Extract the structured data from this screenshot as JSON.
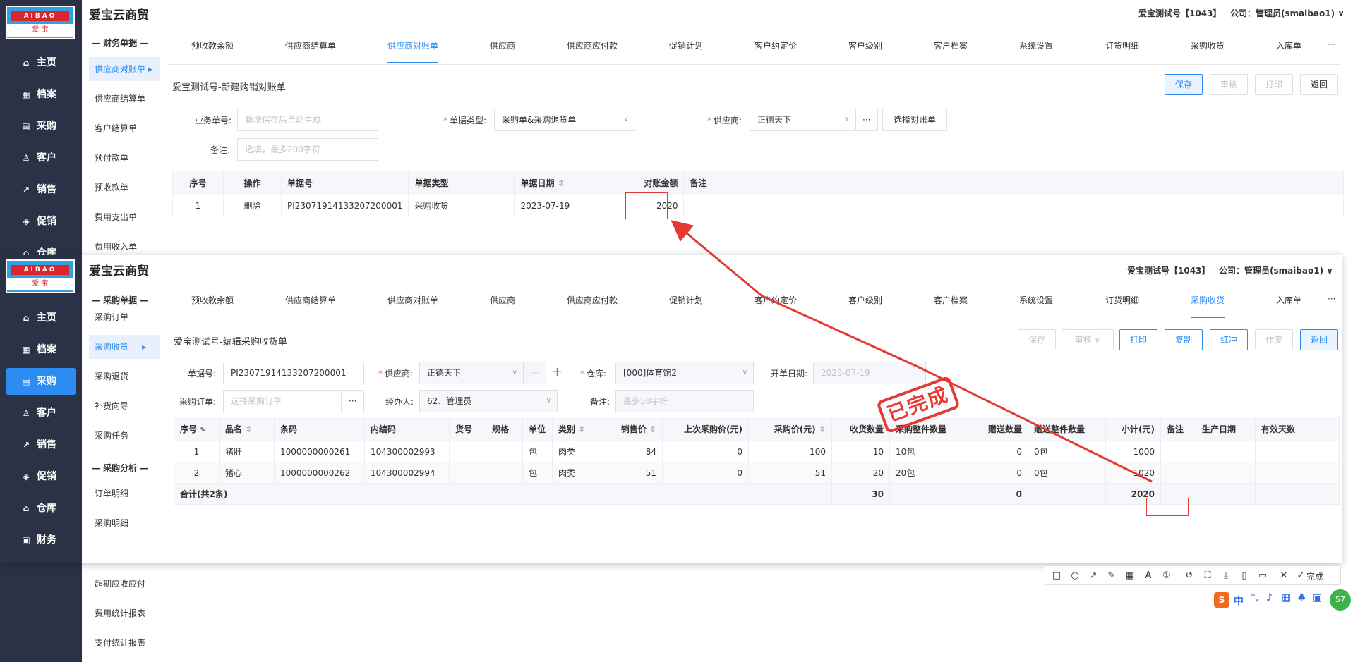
{
  "app": {
    "title": "爱宝云商贸",
    "user": "爱宝测试号【1043】",
    "company": "公司：管理员(smaibao1)",
    "logo_top": "AIBAO",
    "logo_bottom": "爱 宝"
  },
  "back": {
    "nav": [
      {
        "label": "主页",
        "icon": "home-icon"
      },
      {
        "label": "档案",
        "icon": "archive-icon"
      },
      {
        "label": "采购",
        "icon": "purchase-icon"
      },
      {
        "label": "客户",
        "icon": "customer-icon"
      },
      {
        "label": "销售",
        "icon": "sales-icon"
      },
      {
        "label": "促销",
        "icon": "promo-icon"
      },
      {
        "label": "仓库",
        "icon": "warehouse-icon"
      }
    ],
    "section": "— 财务单据 —",
    "sub": [
      "供应商对账单",
      "供应商结算单",
      "客户结算单",
      "预付款单",
      "预收款单",
      "费用支出单",
      "费用收入单"
    ],
    "sub_tail": [
      "超期应收应付",
      "费用统计报表",
      "支付统计报表"
    ],
    "tabs": [
      "预收款余额",
      "供应商结算单",
      "供应商对账单",
      "供应商",
      "供应商应付款",
      "促销计划",
      "客户约定价",
      "客户级别",
      "客户档案",
      "系统设置",
      "订货明细",
      "采购收货",
      "入库单",
      "···"
    ],
    "form_title": "爱宝测试号-新建购销对账单",
    "buttons": [
      "保存",
      "审核",
      "打印",
      "返回"
    ],
    "fields": {
      "doc_no_label": "业务单号:",
      "doc_no_ph": "新增保存后自动生成",
      "doc_type_label": "单据类型:",
      "doc_type": "采购单&采购退货单",
      "supplier_label": "供应商:",
      "supplier": "正德天下",
      "select_btn": "选择对账单",
      "remark_label": "备注:",
      "remark_ph": "选填，最多200字符"
    },
    "table": {
      "headers": [
        "序号",
        "操作",
        "单据号",
        "单据类型",
        "单据日期",
        "对账金额",
        "备注"
      ],
      "rows": [
        [
          "1",
          "删除",
          "PI23071914133207200001",
          "采购收货",
          "2023-07-19",
          "2020",
          ""
        ]
      ]
    }
  },
  "front": {
    "nav": [
      {
        "label": "主页",
        "icon": "home-icon"
      },
      {
        "label": "档案",
        "icon": "archive-icon"
      },
      {
        "label": "采购",
        "icon": "purchase-icon"
      },
      {
        "label": "客户",
        "icon": "customer-icon"
      },
      {
        "label": "销售",
        "icon": "sales-icon"
      },
      {
        "label": "促销",
        "icon": "promo-icon"
      },
      {
        "label": "仓库",
        "icon": "warehouse-icon"
      },
      {
        "label": "财务",
        "icon": "finance-icon"
      }
    ],
    "section1": "— 采购单据 —",
    "sub1": [
      "采购订单",
      "采购收货",
      "采购退货",
      "补货向导",
      "采购任务"
    ],
    "section2": "— 采购分析 —",
    "sub2": [
      "订单明细",
      "采购明细"
    ],
    "tabs": [
      "预收款余额",
      "供应商结算单",
      "供应商对账单",
      "供应商",
      "供应商应付款",
      "促销计划",
      "客户约定价",
      "客户级别",
      "客户档案",
      "系统设置",
      "订货明细",
      "采购收货",
      "入库单",
      "···"
    ],
    "form_title": "爱宝测试号-编辑采购收货单",
    "buttons": [
      "保存",
      "审核",
      "打印",
      "复制",
      "红冲",
      "作废",
      "返回"
    ],
    "fields": {
      "doc_no_label": "单据号:",
      "doc_no": "PI23071914133207200001",
      "supplier_label": "供应商:",
      "supplier": "正德天下",
      "warehouse_label": "仓库:",
      "warehouse": "[000]体育馆2",
      "open_date_label": "开单日期:",
      "open_date": "2023-07-19",
      "po_label": "采购订单:",
      "po_ph": "选择采购订单",
      "handler_label": "经办人:",
      "handler": "62、管理员",
      "remark_label": "备注:",
      "remark_ph": "最多50字符"
    },
    "stamp": "已完成",
    "table": {
      "headers": [
        "序号",
        "品名",
        "条码",
        "内编码",
        "货号",
        "规格",
        "单位",
        "类别",
        "销售价",
        "上次采购价(元)",
        "采购价(元)",
        "收货数量",
        "采购整件数量",
        "赠送数量",
        "赠送整件数量",
        "小计(元)",
        "备注",
        "生产日期",
        "有效天数"
      ],
      "rows": [
        [
          "1",
          "猪肝",
          "1000000000261",
          "104300002993",
          "",
          "",
          "包",
          "肉类",
          "84",
          "0",
          "100",
          "10",
          "10包",
          "0",
          "0包",
          "1000",
          "",
          "",
          ""
        ],
        [
          "2",
          "猪心",
          "1000000000262",
          "104300002994",
          "",
          "",
          "包",
          "肉类",
          "51",
          "0",
          "51",
          "20",
          "20包",
          "0",
          "0包",
          "1020",
          "",
          "",
          ""
        ]
      ],
      "sum_label": "合计(共2条)",
      "sum_qty": "30",
      "sum_gift": "0",
      "sum_total": "2020"
    }
  },
  "snip": {
    "done": "完成"
  },
  "ime": {
    "mode": "中",
    "badge": "57"
  },
  "colors": {
    "accent": "#2d8cf0",
    "sidebar": "#2b3245",
    "annotation": "#e53935"
  }
}
